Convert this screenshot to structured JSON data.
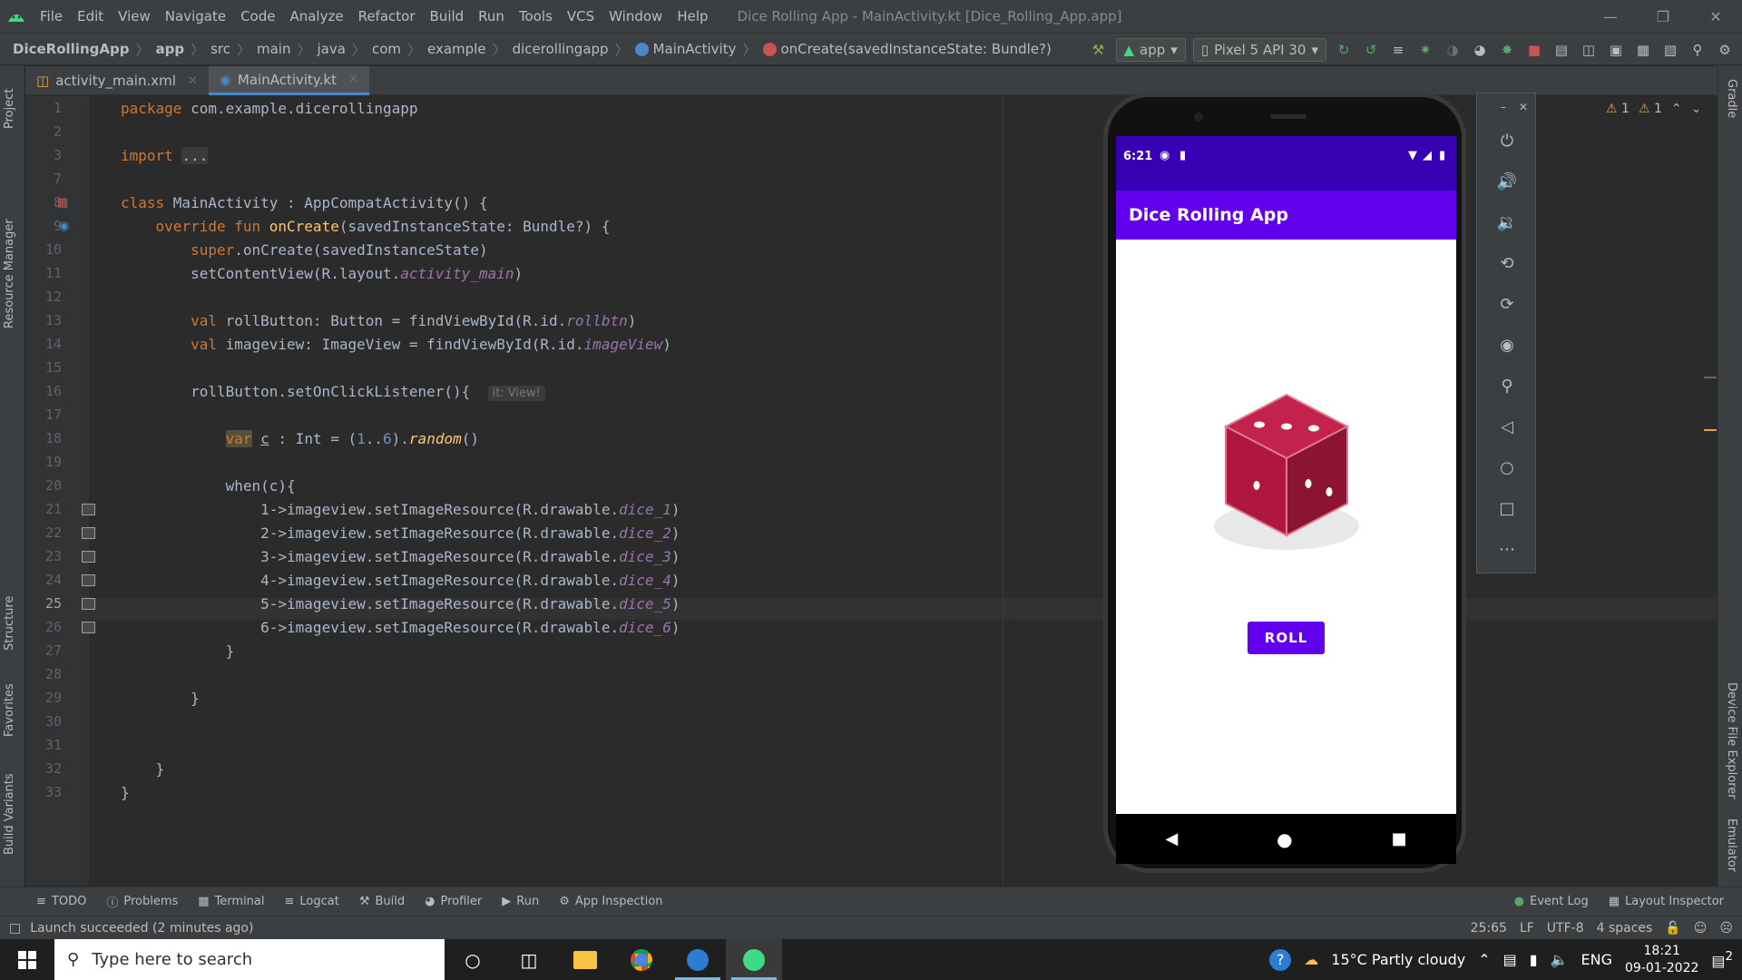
{
  "menu": {
    "items": [
      "File",
      "Edit",
      "View",
      "Navigate",
      "Code",
      "Analyze",
      "Refactor",
      "Build",
      "Run",
      "Tools",
      "VCS",
      "Window",
      "Help"
    ],
    "window_title": "Dice Rolling App - MainActivity.kt [Dice_Rolling_App.app]"
  },
  "breadcrumb": {
    "items": [
      "DiceRollingApp",
      "app",
      "src",
      "main",
      "java",
      "com",
      "example",
      "dicerollingapp",
      "MainActivity",
      "onCreate(savedInstanceState: Bundle?)"
    ]
  },
  "toolbar": {
    "run_config": "app",
    "device": "Pixel 5 API 30"
  },
  "editor_tabs": [
    {
      "label": "activity_main.xml"
    },
    {
      "label": "MainActivity.kt"
    }
  ],
  "code": {
    "current_line": 25,
    "line_numbers": [
      "1",
      "2",
      "3",
      "7",
      "8",
      "9",
      "10",
      "11",
      "12",
      "13",
      "14",
      "15",
      "16",
      "17",
      "18",
      "19",
      "20",
      "21",
      "22",
      "23",
      "24",
      "25",
      "26",
      "27",
      "28",
      "29",
      "30",
      "31",
      "32",
      "33"
    ],
    "lines": {
      "l1": "com.example.dicerollingapp",
      "l3": "...",
      "l8_class": "MainActivity",
      "l8_parent": " : AppCompatActivity() {",
      "l9_params": "(savedInstanceState: Bundle?) {",
      "l10": ".onCreate(savedInstanceState)",
      "l11_a": "setContentView(R.layout.",
      "l11_b": "activity_main",
      "l13_a": " rollButton: Button = findViewById(R.id.",
      "l13_b": "rollbtn",
      "l14_a": " imageview: ImageView = findViewById(R.id.",
      "l14_b": "imageView",
      "l16": "rollButton.setOnClickListener(){",
      "l16_hint": "it: View!",
      "l18_a": " : Int = (",
      "l18_b": "random",
      "l20": "when(c){",
      "when_prefix": "->imageview.setImageResource(R.drawable.",
      "dice": [
        "dice_1",
        "dice_2",
        "dice_3",
        "dice_4",
        "dice_5",
        "dice_6"
      ]
    }
  },
  "emulator": {
    "time": "6:21",
    "app_title": "Dice Rolling App",
    "roll_button": "ROLL"
  },
  "warnings": {
    "warn_count": "1",
    "weak_count": "1"
  },
  "tool_tabs": [
    "TODO",
    "Problems",
    "Terminal",
    "Logcat",
    "Build",
    "Profiler",
    "Run",
    "App Inspection"
  ],
  "tool_tabs_right": [
    "Event Log",
    "Layout Inspector"
  ],
  "status": {
    "message": "Launch succeeded (2 minutes ago)",
    "position": "25:65",
    "line_sep": "LF",
    "encoding": "UTF-8",
    "indent": "4 spaces"
  },
  "side_tabs_left": [
    "Project",
    "Resource Manager",
    "Structure",
    "Favorites",
    "Build Variants"
  ],
  "side_tabs_right": [
    "Gradle",
    "Device File Explorer",
    "Emulator"
  ],
  "taskbar": {
    "search_placeholder": "Type here to search",
    "weather": "15°C  Partly cloudy",
    "lang": "ENG",
    "time": "18:21",
    "date": "09-01-2022",
    "notif_count": "2"
  },
  "colors": {
    "accent": "#6200ee",
    "status": "#3700b3",
    "dice": "#b0173f"
  }
}
